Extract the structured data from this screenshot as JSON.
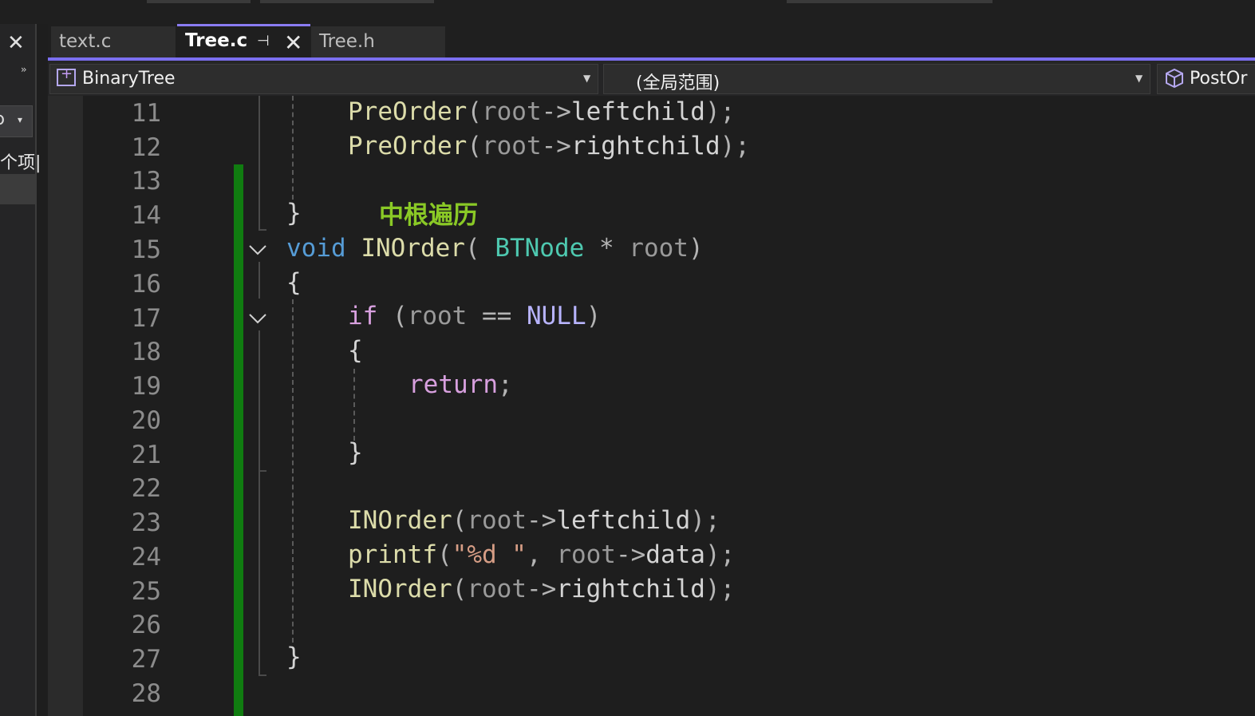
{
  "left_panel": {
    "close_glyph": "✕",
    "overflow_glyph": "››",
    "dropdown_glyph": "ɔ",
    "dropdown_caret": "▾",
    "cjk_fragment": "个项|"
  },
  "tabs": [
    {
      "label": "text.c",
      "active": false
    },
    {
      "label": "Tree.c",
      "active": true,
      "pin_glyph": "⊣",
      "close_glyph": "✕"
    },
    {
      "label": "Tree.h",
      "active": false
    }
  ],
  "navbar": {
    "project": "BinaryTree",
    "scope": "(全局范围)",
    "member": "PostOr"
  },
  "editor": {
    "line_numbers": [
      "11",
      "12",
      "13",
      "14",
      "15",
      "16",
      "17",
      "18",
      "19",
      "20",
      "21",
      "22",
      "23",
      "24",
      "25",
      "26",
      "27",
      "28"
    ],
    "annotation": "中根遍历",
    "lines": {
      "l11": {
        "fn": "PreOrder",
        "paren": "(",
        "param": "root",
        "arrow": "->",
        "member": "leftchild",
        "end": ");"
      },
      "l12": {
        "fn": "PreOrder",
        "paren": "(",
        "param": "root",
        "arrow": "->",
        "member": "rightchild",
        "end": ");"
      },
      "l14": {
        "brace": "}"
      },
      "l15": {
        "kw": "void",
        "fn": "INOrder",
        "open": "( ",
        "type": "BTNode",
        "star": " * ",
        "param": "root",
        "close": ")"
      },
      "l16": {
        "brace": "{"
      },
      "l17": {
        "kw": "if",
        "open": " (",
        "param": "root",
        "op": " == ",
        "mac": "NULL",
        "close": ")"
      },
      "l18": {
        "brace": "{"
      },
      "l19": {
        "kw": "return",
        "end": ";"
      },
      "l21": {
        "brace": "}"
      },
      "l23": {
        "fn": "INOrder",
        "paren": "(",
        "param": "root",
        "arrow": "->",
        "member": "leftchild",
        "end": ");"
      },
      "l24": {
        "fn": "printf",
        "paren": "(",
        "str": "\"%d \"",
        "comma": ", ",
        "param": "root",
        "arrow": "->",
        "member": "data",
        "end": ");"
      },
      "l25": {
        "fn": "INOrder",
        "paren": "(",
        "param": "root",
        "arrow": "->",
        "member": "rightchild",
        "end": ");"
      },
      "l27": {
        "brace": "}"
      }
    }
  },
  "colors": {
    "accent": "#7b6ff0",
    "change_bar": "#107c10",
    "annotation": "#8ac926"
  }
}
